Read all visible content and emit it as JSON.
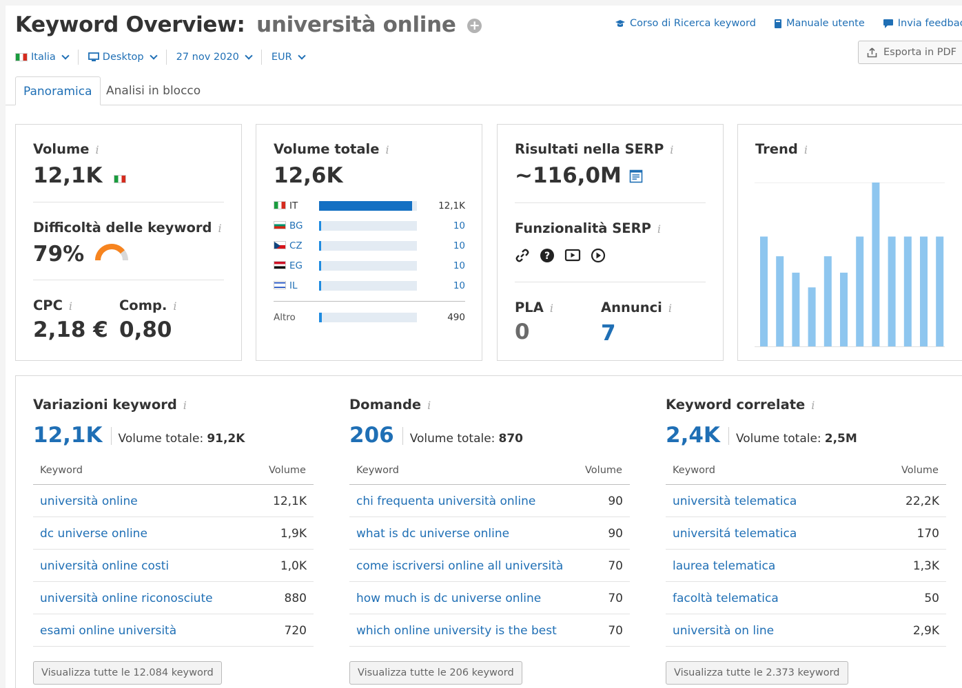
{
  "header": {
    "title_prefix": "Keyword Overview:",
    "keyword": "università online",
    "links": [
      {
        "label": "Corso di Ricerca keyword",
        "icon": "graduation-cap-icon"
      },
      {
        "label": "Manuale utente",
        "icon": "book-icon"
      },
      {
        "label": "Invia feedback",
        "icon": "speech-bubble-icon"
      }
    ],
    "export_label": "Esporta in PDF"
  },
  "filters": {
    "country": "Italia",
    "device": "Desktop",
    "date": "27 nov 2020",
    "currency": "EUR"
  },
  "tabs": [
    {
      "label": "Panoramica",
      "active": true
    },
    {
      "label": "Analisi in blocco",
      "active": false
    }
  ],
  "card_volume": {
    "volume_label": "Volume",
    "volume_value": "12,1K",
    "difficulty_label": "Difficoltà delle keyword",
    "difficulty_value": "79%",
    "difficulty_fraction": 0.79,
    "cpc_label": "CPC",
    "cpc_value": "2,18 €",
    "comp_label": "Comp.",
    "comp_value": "0,80"
  },
  "card_total": {
    "title": "Volume totale",
    "value": "12,6K",
    "countries": [
      {
        "code": "IT",
        "value": "12,1K",
        "fraction": 0.95
      },
      {
        "code": "BG",
        "value": "10",
        "fraction": 0.02
      },
      {
        "code": "CZ",
        "value": "10",
        "fraction": 0.02
      },
      {
        "code": "EG",
        "value": "10",
        "fraction": 0.02
      },
      {
        "code": "IL",
        "value": "10",
        "fraction": 0.02
      }
    ],
    "other_label": "Altro",
    "other_value": "490",
    "other_fraction": 0.03
  },
  "card_serp": {
    "results_label": "Risultati nella SERP",
    "results_value": "~116,0M",
    "features_label": "Funzionalità SERP",
    "feature_icons": [
      "link-icon",
      "question-icon",
      "video-icon",
      "play-icon"
    ],
    "pla_label": "PLA",
    "pla_value": "0",
    "ads_label": "Annunci",
    "ads_value": "7"
  },
  "card_trend": {
    "title": "Trend",
    "bar_color": "#8ec6ef",
    "values": [
      67,
      55,
      45,
      36,
      55,
      45,
      67,
      100,
      67,
      67,
      67,
      67
    ]
  },
  "sections": [
    {
      "title": "Variazioni keyword",
      "count": "12,1K",
      "total_label": "Volume totale:",
      "total_value": "91,2K",
      "col_keyword": "Keyword",
      "col_volume": "Volume",
      "rows": [
        {
          "kw": "università online",
          "vol": "12,1K"
        },
        {
          "kw": "dc universe online",
          "vol": "1,9K"
        },
        {
          "kw": "università online costi",
          "vol": "1,0K"
        },
        {
          "kw": "università online riconosciute",
          "vol": "880"
        },
        {
          "kw": "esami online università",
          "vol": "720"
        }
      ],
      "button": "Visualizza tutte le 12.084 keyword"
    },
    {
      "title": "Domande",
      "count": "206",
      "total_label": "Volume totale:",
      "total_value": "870",
      "col_keyword": "Keyword",
      "col_volume": "Volume",
      "rows": [
        {
          "kw": "chi frequenta università online",
          "vol": "90"
        },
        {
          "kw": "what is dc universe online",
          "vol": "90"
        },
        {
          "kw": "come iscriversi online all università",
          "vol": "70"
        },
        {
          "kw": "how much is dc universe online",
          "vol": "70"
        },
        {
          "kw": "which online university is the best",
          "vol": "70"
        }
      ],
      "button": "Visualizza tutte le 206 keyword"
    },
    {
      "title": "Keyword correlate",
      "count": "2,4K",
      "total_label": "Volume totale:",
      "total_value": "2,5M",
      "col_keyword": "Keyword",
      "col_volume": "Volume",
      "rows": [
        {
          "kw": "università telematica",
          "vol": "22,2K"
        },
        {
          "kw": "universitá telematica",
          "vol": "170"
        },
        {
          "kw": "laurea telematica",
          "vol": "1,3K"
        },
        {
          "kw": "facoltà telematica",
          "vol": "50"
        },
        {
          "kw": "università on line",
          "vol": "2,9K"
        }
      ],
      "button": "Visualizza tutte le 2.373 keyword"
    }
  ],
  "colors": {
    "link": "#1f6fb5",
    "difficulty_gauge": "#f7841f",
    "bar_main": "#1470c3"
  }
}
